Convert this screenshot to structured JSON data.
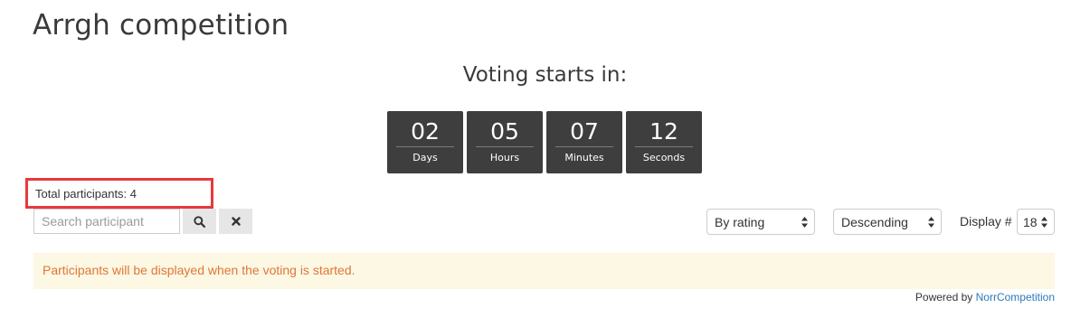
{
  "page": {
    "title": "Arrgh competition"
  },
  "voting": {
    "heading": "Voting starts in:"
  },
  "countdown": [
    {
      "value": "02",
      "label": "Days"
    },
    {
      "value": "05",
      "label": "Hours"
    },
    {
      "value": "07",
      "label": "Minutes"
    },
    {
      "value": "12",
      "label": "Seconds"
    }
  ],
  "participants": {
    "total_label": "Total participants: 4",
    "highlight_color": "#e8393a"
  },
  "search": {
    "placeholder": "Search participant",
    "value": ""
  },
  "icons": {
    "search": "search-icon",
    "clear": "close-icon",
    "select_arrows": "sort-arrows-icon"
  },
  "sort": {
    "selected": "By rating"
  },
  "order": {
    "selected": "Descending"
  },
  "display": {
    "label": "Display #",
    "selected": "18"
  },
  "notice": {
    "text": "Participants will be displayed when the voting is started.",
    "bg_color": "#fcf8e3",
    "text_color": "#e0763a"
  },
  "footer": {
    "powered_by": "Powered by",
    "brand": "NorrCompetition",
    "brand_color": "#2a7ab8"
  }
}
